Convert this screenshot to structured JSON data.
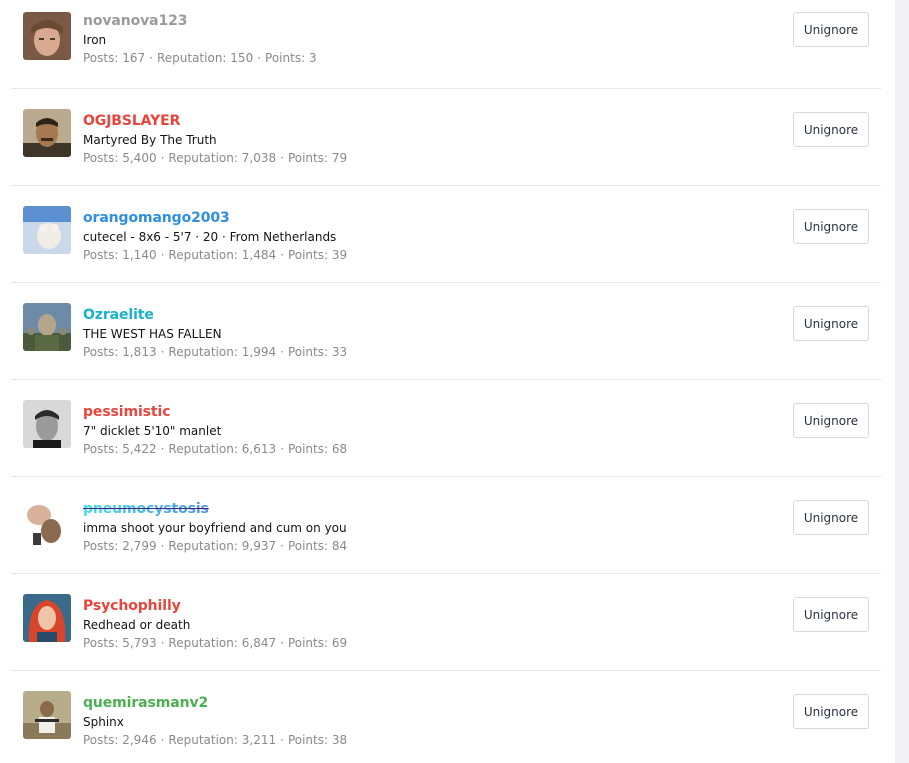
{
  "button_label": "Unignore",
  "stat_labels": {
    "posts": "Posts:",
    "reputation": "Reputation:",
    "points": "Points:"
  },
  "members": [
    {
      "username": "novanova123",
      "color": "#9a9a9a",
      "title": "Iron",
      "posts": "167",
      "reputation": "150",
      "points": "3"
    },
    {
      "username": "OGJBSLAYER",
      "color": "#e8453c",
      "title": "Martyred By The Truth",
      "posts": "5,400",
      "reputation": "7,038",
      "points": "79"
    },
    {
      "username": "orangomango2003",
      "color": "#2f8fe0",
      "title": "cutecel - 8x6 - 5'7 · 20 · From Netherlands",
      "posts": "1,140",
      "reputation": "1,484",
      "points": "39"
    },
    {
      "username": "Ozraelite",
      "color": "#1ab3c9",
      "title": "THE WEST HAS FALLEN",
      "posts": "1,813",
      "reputation": "1,994",
      "points": "33"
    },
    {
      "username": "pessimistic",
      "color": "#e8453c",
      "title": "7\" dicklet 5'10\" manlet",
      "posts": "5,422",
      "reputation": "6,613",
      "points": "68"
    },
    {
      "username": "pneumocystosis",
      "color": "#6a3fd6",
      "title": "imma shoot your boyfriend and cum on you",
      "posts": "2,799",
      "reputation": "9,937",
      "points": "84"
    },
    {
      "username": "Psychophilly",
      "color": "#e8453c",
      "title": "Redhead or death",
      "posts": "5,793",
      "reputation": "6,847",
      "points": "69"
    },
    {
      "username": "quemirasmanv2",
      "color": "#4caf50",
      "title": "Sphinx",
      "posts": "2,946",
      "reputation": "3,211",
      "points": "38"
    }
  ]
}
